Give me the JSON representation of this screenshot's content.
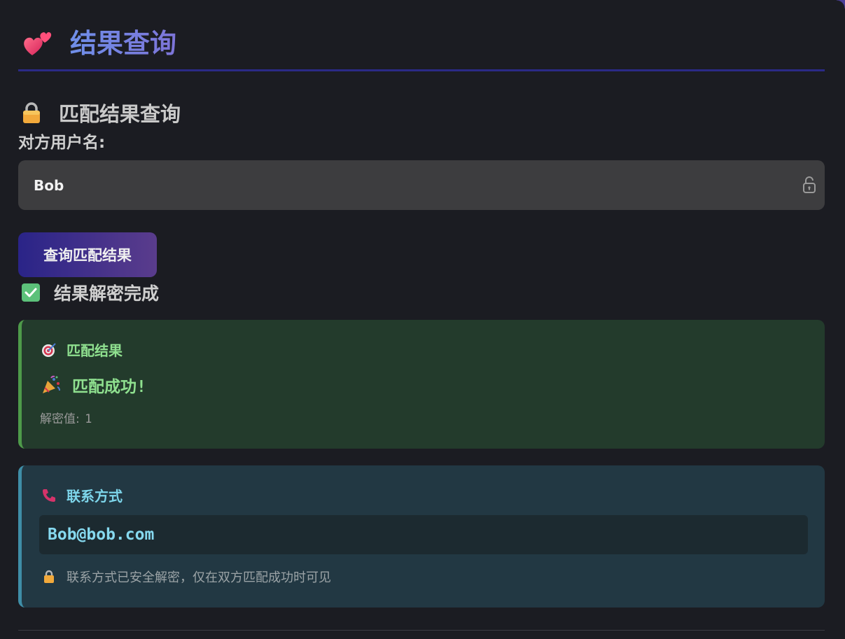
{
  "header": {
    "title": "结果查询",
    "icon": "two-hearts-icon"
  },
  "section": {
    "title": "匹配结果查询",
    "icon": "lock-icon"
  },
  "form": {
    "label": "对方用户名:",
    "username_value": "Bob",
    "input_icon": "unlock-icon",
    "query_button": "查询匹配结果"
  },
  "status": {
    "icon": "check-icon",
    "text": "结果解密完成"
  },
  "result_card": {
    "icon": "target-icon",
    "title": "匹配结果",
    "success_icon": "party-popper-icon",
    "success_text": "匹配成功!",
    "decrypt_label": "解密值:",
    "decrypt_value": "1",
    "accent_color": "#4e9a4a"
  },
  "contact_card": {
    "icon": "phone-icon",
    "title": "联系方式",
    "email": "Bob@bob.com",
    "note_icon": "lock-icon",
    "note": "联系方式已安全解密，仅在双方匹配成功时可见",
    "accent_color": "#3f8ea7"
  }
}
